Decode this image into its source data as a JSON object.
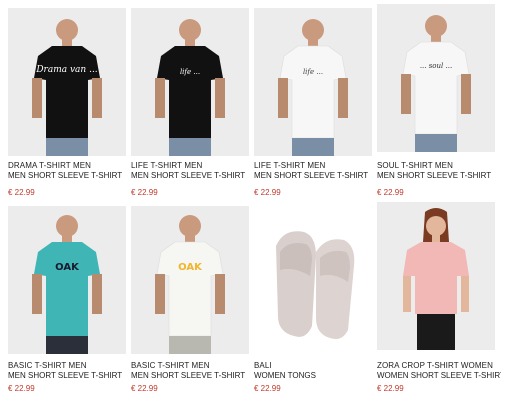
{
  "colors": {
    "price": "#c0392b",
    "image_bg": "#ececec"
  },
  "products": [
    {
      "name": "DRAMA T-SHIRT MEN",
      "subtitle": "MEN SHORT SLEEVE T-SHIRT",
      "price": "€ 22.99",
      "shirt_color": "#111111",
      "print": "Drama van ...",
      "print_color": "#ffffff"
    },
    {
      "name": "LIFE T-SHIRT MEN",
      "subtitle": "MEN SHORT SLEEVE T-SHIRT",
      "price": "€ 22.99",
      "shirt_color": "#111111",
      "print": "life ...",
      "print_color": "#ffffff"
    },
    {
      "name": "LIFE T-SHIRT MEN",
      "subtitle": "MEN SHORT SLEEVE T-SHIRT",
      "price": "€ 22.99",
      "shirt_color": "#f4f4f4",
      "print": "life ...",
      "print_color": "#444444"
    },
    {
      "name": "SOUL T-SHIRT MEN",
      "subtitle": "MEN SHORT SLEEVE T-SHIRT",
      "price": "€ 22.99",
      "shirt_color": "#f4f4f4",
      "print": "... soul ...",
      "print_color": "#333333"
    },
    {
      "name": "BASIC T-SHIRT MEN",
      "subtitle": "MEN SHORT SLEEVE T-SHIRT",
      "price": "€ 22.99",
      "shirt_color": "#3fb6b5",
      "print": "OAK",
      "print_color": "#1a1a2e"
    },
    {
      "name": "BASIC T-SHIRT MEN",
      "subtitle": "MEN SHORT SLEEVE T-SHIRT",
      "price": "€ 22.99",
      "shirt_color": "#f4f4f0",
      "print": "OAK",
      "print_color": "#f2b52a"
    },
    {
      "name": "BALI",
      "subtitle": "WOMEN TONGS",
      "price": "€ 22.99",
      "shirt_color": "#d9cfcc",
      "print": "",
      "print_color": "#d9cfcc"
    },
    {
      "name": "ZORA CROP T-SHIRT WOMEN",
      "subtitle": "WOMEN SHORT SLEEVE T-SHIRT",
      "price": "€ 22.99",
      "shirt_color": "#f1b8b6",
      "print": "",
      "print_color": "#f1b8b6"
    }
  ]
}
